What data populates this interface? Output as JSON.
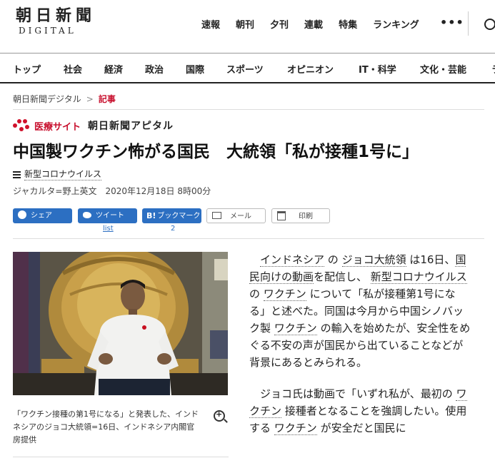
{
  "header": {
    "logo_main": "朝日新聞",
    "logo_sub": "DIGITAL",
    "top_nav": [
      "速報",
      "朝刊",
      "夕刊",
      "連載",
      "特集",
      "ランキング"
    ],
    "more": "•••"
  },
  "categories": [
    "トップ",
    "社会",
    "経済",
    "政治",
    "国際",
    "スポーツ",
    "オピニオン",
    "IT・科学",
    "文化・芸能",
    "ラ"
  ],
  "breadcrumb": {
    "home": "朝日新聞デジタル",
    "separator": ">",
    "current": "記事"
  },
  "apital": {
    "label": "医療サイト",
    "name": "朝日新聞アピタル"
  },
  "article": {
    "title": "中国製ワクチン怖がる国民　大統領「私が接種1号に」",
    "topic": "新型コロナウイルス",
    "author": "ジャカルタ=野上英文",
    "date": "2020年12月18日 8時00分"
  },
  "share": {
    "facebook": "シェア",
    "twitter": "ツイート",
    "twitter_count": "list",
    "hatena": "ブックマーク",
    "hatena_mark": "B!",
    "hatena_count": "2",
    "mail": "メール",
    "print": "印刷"
  },
  "photo": {
    "caption": "「ワクチン接種の第1号になる」と発表した、インドネシアのジョコ大統領=16日、インドネシア内閣官房提供"
  },
  "body": {
    "p1": {
      "kw1": "インドネシア",
      "t1": " の ",
      "kw2": "ジョコ大統領",
      "t2": " は16日、",
      "kw3": "国民向けの動画",
      "t3": "を配信し、 ",
      "kw4": "新型コロナウイルス",
      "t4": " の ",
      "kw5": "ワクチン",
      "t5": " について「私が接種第1号になる」と述べた。同国は今月から中国シノバック製 ",
      "kw6": "ワクチン",
      "t6": " の輸入を始めたが、安全性をめぐる不安の声が国民から出ていることなどが背景にあるとみられる。"
    },
    "p2": {
      "t1": "ジョコ氏は動画で「いずれ私が、最初の ",
      "kw1": "ワクチン",
      "t2": " 接種者となることを強調したい。使用する ",
      "kw2": "ワクチン",
      "t3": " が安全だと国民に"
    }
  },
  "colors": {
    "accent": "#c8102e",
    "share_blue": "#2c6fc2"
  }
}
